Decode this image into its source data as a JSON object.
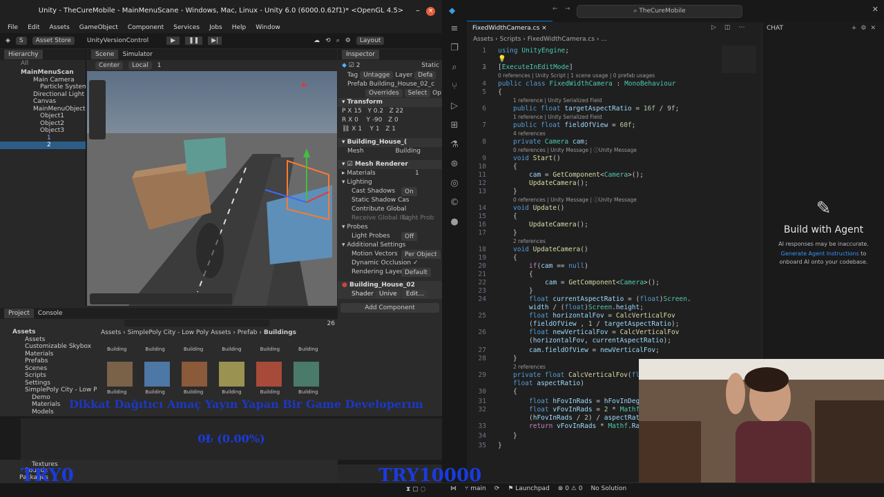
{
  "unity": {
    "title": "Unity - TheCureMobile - MainMenuScane - Windows, Mac, Linux - Unity 6.0 (6000.0.62f1)* <OpenGL 4.5>",
    "menu": [
      "File",
      "Edit",
      "Assets",
      "GameObject",
      "Component",
      "Services",
      "Jobs",
      "Help",
      "Window"
    ],
    "toolbar": {
      "account": "S",
      "asset_store": "Asset Store",
      "version_control": "UnityVersionControl",
      "layout": "Layout"
    },
    "hierarchy": {
      "tab": "Hierarchy",
      "search": "All",
      "items": [
        "MainMenuScan",
        "Main Camera",
        "Particle System",
        "Directional Light",
        "Canvas",
        "MainMenuObject",
        "Object1",
        "Object2",
        "Object3",
        "1",
        "2"
      ]
    },
    "scene": {
      "tab_scene": "Scene",
      "tab_sim": "Simulator",
      "pivot": "Center",
      "space": "Local",
      "grid": "1"
    },
    "inspector": {
      "tab": "Inspector",
      "name": "2",
      "static": "Static",
      "tag_label": "Tag",
      "tag": "Untagge",
      "layer_label": "Layer",
      "layer": "Defa",
      "prefab_label": "Prefab",
      "prefab": "Building_House_02_c",
      "overrides": "Overrides",
      "select": "Select",
      "open": "Op",
      "transform": "Transform",
      "pos": {
        "x": "15",
        "y": "0.2",
        "z": "22"
      },
      "rot": {
        "x": "0",
        "y": "-90",
        "z": "0"
      },
      "scale": {
        "x": "1",
        "y": "1",
        "z": "1"
      },
      "mesh_filter": "Building_House_(",
      "mesh_label": "Mesh",
      "mesh": "Building",
      "mesh_renderer": "Mesh Renderer",
      "materials": "Materials",
      "materials_count": "1",
      "lighting": "Lighting",
      "cast_shadows": "Cast Shadows",
      "cast_shadows_val": "On",
      "static_shadow": "Static Shadow Cas",
      "contribute_gi": "Contribute Global",
      "receive_gi": "Receive Global Illu",
      "receive_gi_val": "Light Prob",
      "probes": "Probes",
      "light_probes": "Light Probes",
      "light_probes_val": "Off",
      "additional": "Additional Settings",
      "motion_vectors": "Motion Vectors",
      "motion_vectors_val": "Per Object",
      "dynamic_occlusion": "Dynamic Occlusion",
      "rendering_layer": "Rendering Layer M",
      "rendering_layer_val": "Default",
      "material": "Building_House_02",
      "shader_label": "Shader",
      "shader": "Unive",
      "edit": "Edit...",
      "add_component": "Add Component"
    },
    "project": {
      "tab_project": "Project",
      "tab_console": "Console",
      "count": "26",
      "breadcrumb": [
        "Assets",
        "SimplePoly City - Low Poly Assets",
        "Prefab",
        "Buildings"
      ],
      "folders": [
        "Assets",
        "Assets",
        "Customizable Skybox",
        "Materials",
        "Prefabs",
        "Scenes",
        "Scripts",
        "Settings",
        "SimplePoly City - Low Pol",
        "Demo",
        "Materials",
        "Models",
        "Textures",
        "Sounds",
        "Packages"
      ],
      "items_top": [
        "Building",
        "Building",
        "Building",
        "Building",
        "Building",
        "Building"
      ],
      "items_bottom": [
        "Building",
        "Building",
        "Building",
        "Building",
        "Building",
        "Building"
      ]
    }
  },
  "overlay": {
    "banner": "Dikkat Dağıtıcı Amaç Yayın Yapan Bir Game Developerım",
    "progress": "0₺ (0.00%)",
    "left_big": "TRY0",
    "right_big": "TRY10000"
  },
  "vscode": {
    "search": "TheCureMobile",
    "tab": "FixedWidthCamera.cs",
    "breadcrumb": [
      "Assets",
      "Scripts",
      "FixedWidthCamera.cs",
      "..."
    ],
    "chat": {
      "tab": "CHAT",
      "heading": "Build with Agent",
      "line1": "AI responses may be inaccurate.",
      "link": "Generate Agent Instructions",
      "line2": " to",
      "line3": "onboard AI onto your codebase."
    },
    "status": {
      "branch": "main",
      "launchpad": "Launchpad",
      "errors": "0",
      "warnings": "0",
      "solution": "No Solution"
    },
    "lens": {
      "l3": "0 references | Unity Script | 1 scene usage | 0 prefab usages",
      "l6": "1 reference | Unity Serialized Field",
      "l7": "1 reference | Unity Serialized Field",
      "l8": "4 references",
      "l9": "0 references | Unity Message | ⓘUnity Message",
      "l14": "0 references | Unity Message | ⓘUnity Message",
      "l18": "2 references",
      "l29": "2 references"
    }
  },
  "colors": {
    "accent": "#0078d4",
    "unity_bg": "#282828",
    "vs_bg": "#1f1f1f"
  },
  "icons": [
    "search-icon",
    "gear-icon",
    "close-icon",
    "play-icon",
    "pause-icon",
    "step-icon",
    "cloud-icon",
    "history-icon",
    "explorer-icon",
    "source-control-icon",
    "run-debug-icon",
    "extensions-icon"
  ]
}
